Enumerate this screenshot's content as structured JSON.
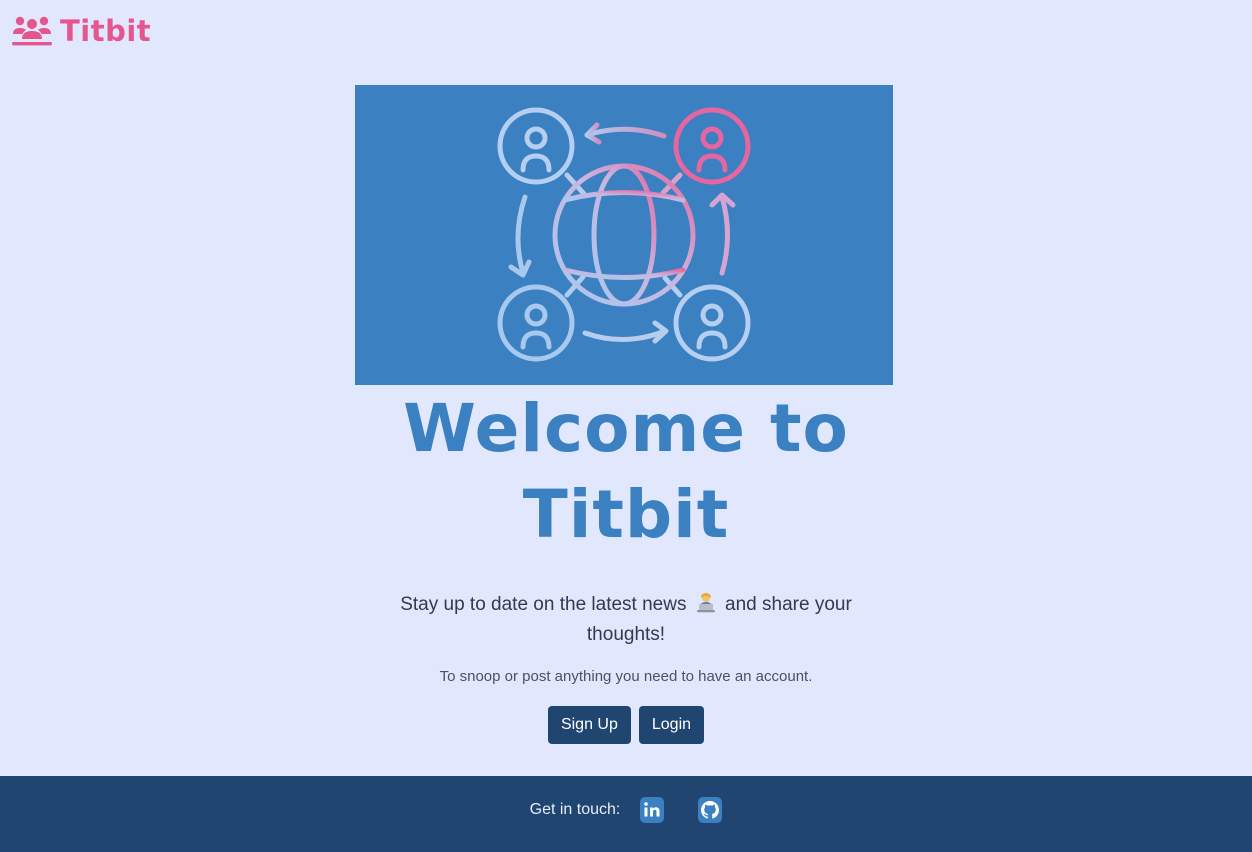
{
  "header": {
    "brand_name": "Titbit",
    "brand_icon": "users-icon",
    "brand_color": "#e5568f"
  },
  "hero": {
    "image_icon": "global-network-icon",
    "title": "Welcome to Titbit",
    "tagline_before": "Stay up to date on the latest news",
    "tagline_emoji": "technologist-emoji",
    "tagline_after": "and share your thoughts!",
    "notice": "To snoop or post anything you need to have an account."
  },
  "actions": {
    "signup_label": "Sign Up",
    "login_label": "Login"
  },
  "footer": {
    "label": "Get in touch:",
    "links": [
      {
        "icon": "linkedin-icon"
      },
      {
        "icon": "github-icon"
      }
    ]
  },
  "colors": {
    "background": "#e1e7fd",
    "accent_blue": "#3b80c1",
    "dark_navy": "#204570"
  }
}
